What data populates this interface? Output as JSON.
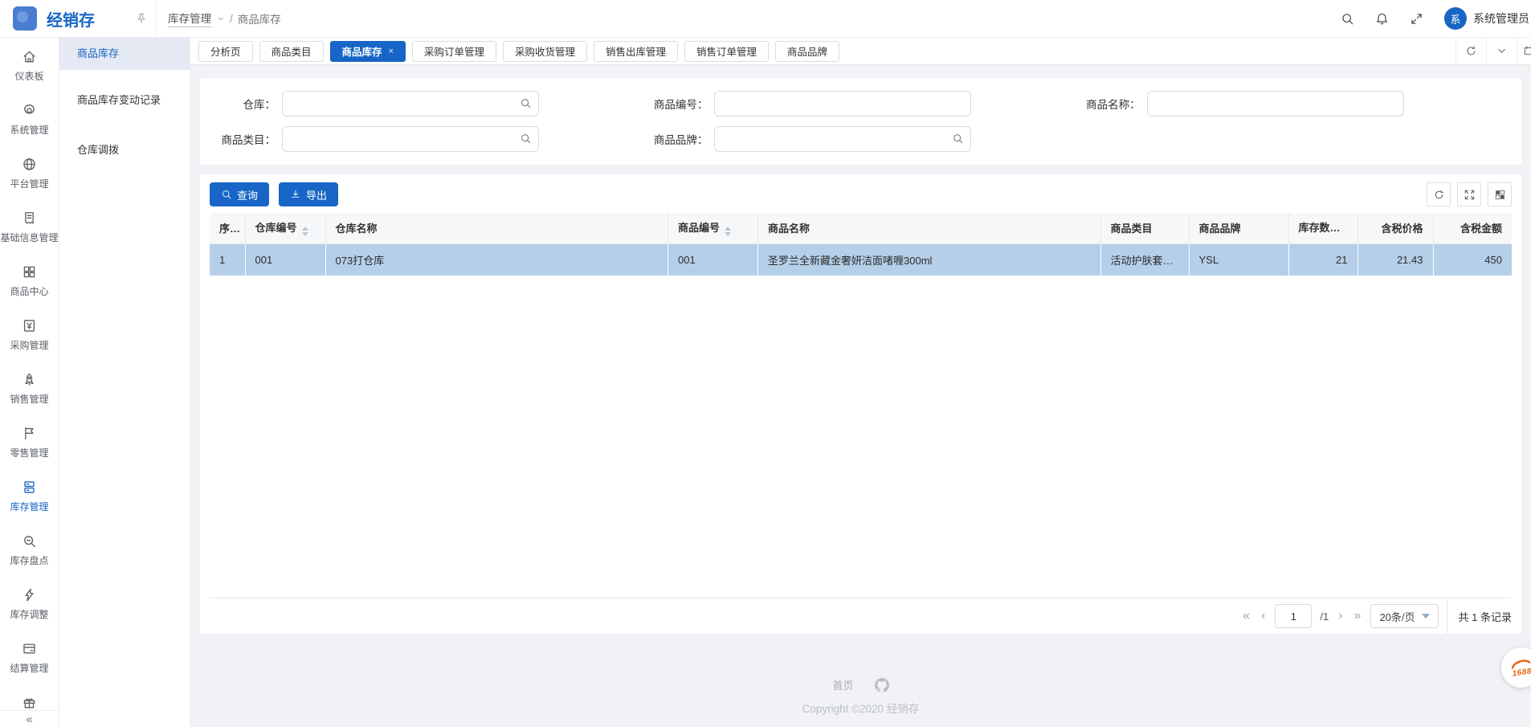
{
  "colors": {
    "primary": "#1765c6",
    "selected_row": "#b5cfe9",
    "page_bg": "#f0f2f5"
  },
  "header": {
    "app_title": "经销存",
    "breadcrumb": {
      "section": "库存管理",
      "separator": "/",
      "current": "商品库存"
    },
    "actions": [
      "search",
      "bell",
      "fullscreen"
    ],
    "user": {
      "avatar_text": "系",
      "name": "系统管理员"
    }
  },
  "icon_sidebar": {
    "items": [
      {
        "name": "dashboard",
        "icon": "home",
        "label": "仪表板",
        "active": false
      },
      {
        "name": "system",
        "icon": "gear",
        "label": "系统管理",
        "active": false
      },
      {
        "name": "platform",
        "icon": "globe",
        "label": "平台管理",
        "active": false
      },
      {
        "name": "base-info",
        "icon": "doc",
        "label": "基础信息管理",
        "active": false
      },
      {
        "name": "product-center",
        "icon": "grid",
        "label": "商品中心",
        "active": false
      },
      {
        "name": "purchase",
        "icon": "pay",
        "label": "采购管理",
        "active": false
      },
      {
        "name": "sales",
        "icon": "rocket",
        "label": "销售管理",
        "active": false
      },
      {
        "name": "retail",
        "icon": "flag",
        "label": "零售管理",
        "active": false
      },
      {
        "name": "inventory",
        "icon": "database",
        "label": "库存管理",
        "active": true
      },
      {
        "name": "stocktake",
        "icon": "zoom",
        "label": "库存盘点",
        "active": false
      },
      {
        "name": "adjust",
        "icon": "thunder",
        "label": "库存调整",
        "active": false
      },
      {
        "name": "settlement",
        "icon": "card",
        "label": "结算管理",
        "active": false
      },
      {
        "name": "promotion",
        "icon": "gift",
        "label": "",
        "active": false
      }
    ],
    "collapse_glyph": "«"
  },
  "submenu": {
    "items": [
      {
        "name": "product-stock",
        "label": "商品库存",
        "active": true
      },
      {
        "name": "stock-change-log",
        "label": "商品库存变动记录",
        "active": false
      },
      {
        "name": "warehouse-transfer",
        "label": "仓库调拨",
        "active": false
      }
    ]
  },
  "tabbar": {
    "close_glyph": "×",
    "actions": [
      "reload",
      "collapse",
      "fullscreen"
    ],
    "tabs": [
      {
        "name": "analysis",
        "label": "分析页",
        "active": false,
        "closable": false
      },
      {
        "name": "product-category",
        "label": "商品类目",
        "active": false,
        "closable": false
      },
      {
        "name": "product-stock",
        "label": "商品库存",
        "active": true,
        "closable": true
      },
      {
        "name": "purchase-order",
        "label": "采购订单管理",
        "active": false,
        "closable": false
      },
      {
        "name": "purchase-receipt",
        "label": "采购收货管理",
        "active": false,
        "closable": false
      },
      {
        "name": "sales-outbound",
        "label": "销售出库管理",
        "active": false,
        "closable": false
      },
      {
        "name": "sales-order",
        "label": "销售订单管理",
        "active": false,
        "closable": false
      },
      {
        "name": "product-brand",
        "label": "商品品牌",
        "active": false,
        "closable": false
      }
    ]
  },
  "filters": {
    "fields": [
      {
        "name": "warehouse",
        "label": "仓库：",
        "value": "",
        "search_suffix": true
      },
      {
        "name": "product-code",
        "label": "商品编号：",
        "value": "",
        "search_suffix": false
      },
      {
        "name": "product-name",
        "label": "商品名称：",
        "value": "",
        "search_suffix": false
      },
      {
        "name": "category",
        "label": "商品类目：",
        "value": "",
        "search_suffix": true
      },
      {
        "name": "brand",
        "label": "商品品牌：",
        "value": "",
        "search_suffix": true
      }
    ]
  },
  "toolbar": {
    "query_label": "查询",
    "export_label": "导出",
    "actions": [
      "refresh",
      "expand",
      "columns"
    ]
  },
  "table": {
    "columns": [
      {
        "key": "index",
        "label": "序号",
        "sortable": false,
        "align": "left"
      },
      {
        "key": "warehouse_code",
        "label": "仓库编号",
        "sortable": true,
        "align": "left"
      },
      {
        "key": "warehouse_name",
        "label": "仓库名称",
        "sortable": false,
        "align": "left"
      },
      {
        "key": "product_code",
        "label": "商品编号",
        "sortable": true,
        "align": "left"
      },
      {
        "key": "product_name",
        "label": "商品名称",
        "sortable": false,
        "align": "left"
      },
      {
        "key": "category",
        "label": "商品类目",
        "sortable": false,
        "align": "left"
      },
      {
        "key": "brand",
        "label": "商品品牌",
        "sortable": false,
        "align": "left"
      },
      {
        "key": "qty",
        "label": "库存数量",
        "sortable": true,
        "align": "right"
      },
      {
        "key": "price",
        "label": "含税价格",
        "sortable": false,
        "align": "right"
      },
      {
        "key": "amount",
        "label": "含税金额",
        "sortable": false,
        "align": "right"
      }
    ],
    "rows": [
      {
        "index": "1",
        "warehouse_code": "001",
        "warehouse_name": "073打仓库",
        "product_code": "001",
        "product_name": "圣罗兰全新藏金奢妍洁面啫喱300ml",
        "category": "活动护肤套装...",
        "brand": "YSL",
        "qty": "21",
        "price": "21.43",
        "amount": "450",
        "selected": true
      }
    ]
  },
  "pagination": {
    "current": "1",
    "total_pages": "/1",
    "page_size": "20条/页",
    "total_text": "共 1 条记录"
  },
  "footer": {
    "link": "首页",
    "copyright": "Copyright ©2020 经销存"
  },
  "badge": {
    "text": "1688"
  }
}
